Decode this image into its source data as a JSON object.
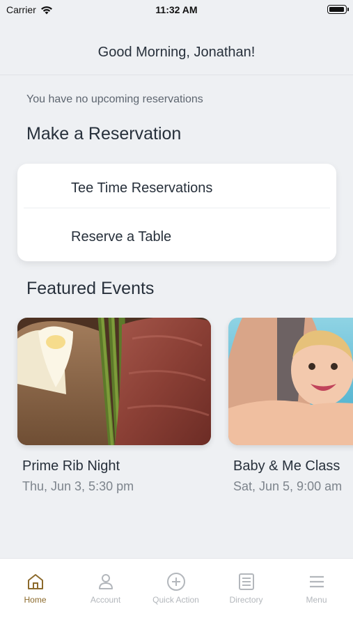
{
  "status_bar": {
    "carrier": "Carrier",
    "time": "11:32 AM"
  },
  "header": {
    "greeting": "Good Morning, Jonathan!"
  },
  "reservations": {
    "empty_message": "You have no upcoming reservations",
    "section_title": "Make a Reservation",
    "options": [
      {
        "label": "Tee Time Reservations"
      },
      {
        "label": "Reserve a Table"
      }
    ]
  },
  "featured": {
    "section_title": "Featured Events",
    "events": [
      {
        "title": "Prime Rib Night",
        "date": "Thu, Jun 3, 5:30 pm"
      },
      {
        "title": "Baby & Me Class",
        "date": "Sat, Jun 5, 9:00 am"
      }
    ]
  },
  "tab_bar": {
    "tabs": [
      {
        "label": "Home",
        "icon": "home-icon",
        "active": true
      },
      {
        "label": "Account",
        "icon": "person-icon",
        "active": false
      },
      {
        "label": "Quick Action",
        "icon": "plus-circle-icon",
        "active": false
      },
      {
        "label": "Directory",
        "icon": "directory-icon",
        "active": false
      },
      {
        "label": "Menu",
        "icon": "hamburger-icon",
        "active": false
      }
    ],
    "active_color": "#8c6a2c",
    "inactive_color": "#b3b7bc"
  }
}
